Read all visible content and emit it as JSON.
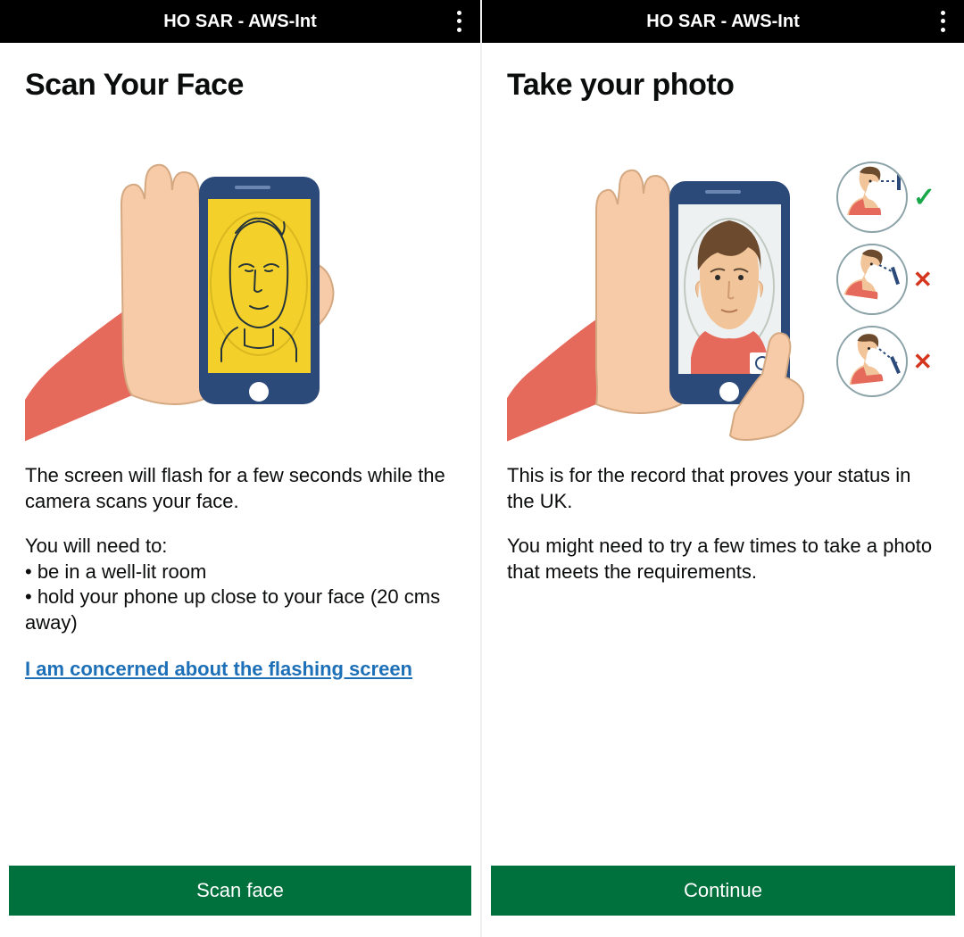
{
  "left": {
    "app_title": "HO SAR - AWS-Int",
    "title": "Scan Your Face",
    "paragraph1": "The screen will flash for a few seconds while the camera scans your face.",
    "need_lead": "You will need to:",
    "bullet1": "• be in a well-lit room",
    "bullet2": "• hold your phone up close to your face (20 cms away)",
    "concern_link": "I am concerned about the flashing screen",
    "button": "Scan face"
  },
  "right": {
    "app_title": "HO SAR - AWS-Int",
    "title": "Take your photo",
    "paragraph1": "This is for the record that proves your status in the UK.",
    "paragraph2": "You might need to try a few times to take a photo that meets the requirements.",
    "button": "Continue",
    "tips": {
      "ok": "✓",
      "no": "✕"
    }
  },
  "colors": {
    "primary_green": "#00703c",
    "link_blue": "#1d70b8",
    "error_red": "#d4351c",
    "success_green": "#1aa84b"
  }
}
